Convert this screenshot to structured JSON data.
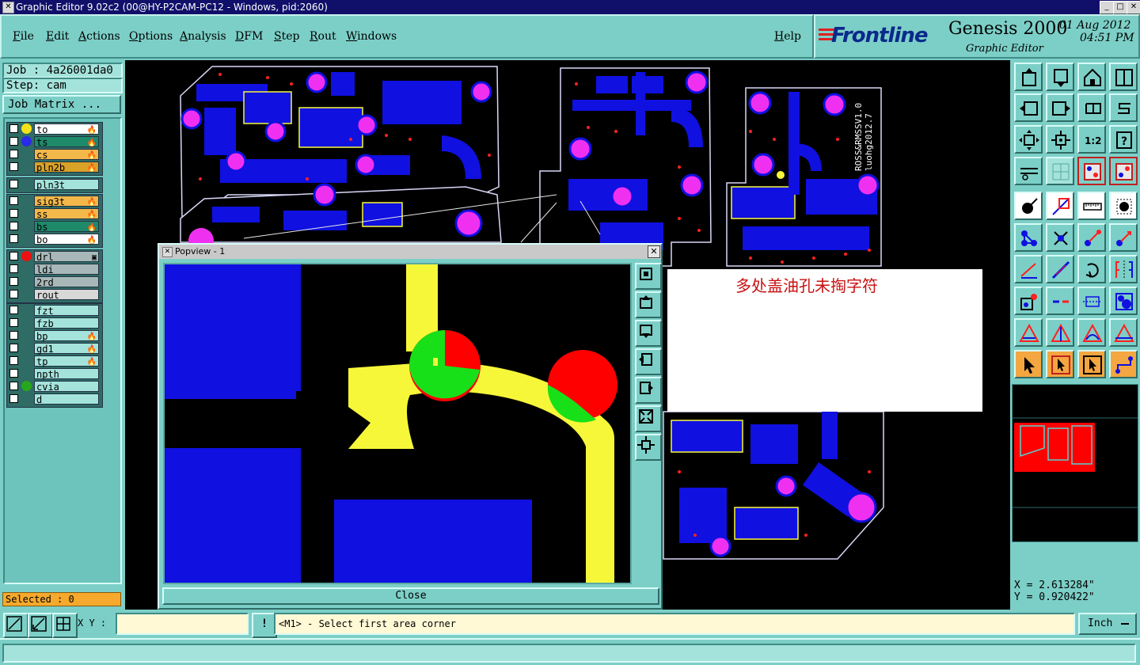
{
  "window": {
    "title": "Graphic Editor 9.02c2 (00@HY-P2CAM-PC12 - Windows, pid:2060)",
    "controls": [
      "_",
      "□",
      "✕"
    ]
  },
  "menu": {
    "items": [
      "File",
      "Edit",
      "Actions",
      "Options",
      "Analysis",
      "DFM",
      "Step",
      "Rout",
      "Windows"
    ],
    "help": "Help"
  },
  "brand": {
    "logo": "Frontline",
    "product": "Genesis 2000",
    "subtitle": "Graphic Editor",
    "date": "01 Aug 2012",
    "time": "04:51 PM"
  },
  "job": {
    "job_label": "Job : 4a26001da0",
    "step_label": "Step: cam",
    "matrix_button": "Job Matrix ..."
  },
  "layers": {
    "groups": [
      [
        {
          "name": "to",
          "bg": "#ffffff",
          "dot": "#f6e21a",
          "flame": "🔥"
        },
        {
          "name": "ts",
          "bg": "#1f8a6a",
          "dot": "#2a2ae8",
          "flame": "🔥"
        },
        {
          "name": "cs",
          "bg": "#f2b84a",
          "dot": "",
          "flame": "🔥"
        },
        {
          "name": "pln2b",
          "bg": "#d9a126",
          "dot": "",
          "flame": "🔥"
        }
      ],
      [
        {
          "name": "pln3t",
          "bg": "#a4e3db",
          "dot": "",
          "flame": ""
        }
      ],
      [
        {
          "name": "sig3t",
          "bg": "#f2b84a",
          "dot": "",
          "flame": "🔥"
        },
        {
          "name": "ss",
          "bg": "#f2b84a",
          "dot": "",
          "flame": "🔥"
        },
        {
          "name": "bs",
          "bg": "#1f8a6a",
          "dot": "",
          "flame": "🔥"
        },
        {
          "name": "bo",
          "bg": "#ffffff",
          "dot": "",
          "flame": "🔥"
        }
      ],
      [
        {
          "name": "drl",
          "bg": "#a8b8b8",
          "dot": "#ee1010",
          "flame": "▣"
        },
        {
          "name": "ldi",
          "bg": "#a8b8b8",
          "dot": "",
          "flame": ""
        },
        {
          "name": "2rd",
          "bg": "#a8b8b8",
          "dot": "",
          "flame": ""
        },
        {
          "name": "rout",
          "bg": "#d8d8d8",
          "dot": "",
          "flame": ""
        }
      ],
      [
        {
          "name": "fzt",
          "bg": "#a4e3db",
          "dot": "",
          "flame": ""
        },
        {
          "name": "fzb",
          "bg": "#a4e3db",
          "dot": "",
          "flame": ""
        },
        {
          "name": "bp",
          "bg": "#a4e3db",
          "dot": "",
          "flame": "🔥"
        },
        {
          "name": "gd1",
          "bg": "#a4e3db",
          "dot": "",
          "flame": "🔥"
        },
        {
          "name": "tp",
          "bg": "#a4e3db",
          "dot": "",
          "flame": "🔥"
        },
        {
          "name": "npth",
          "bg": "#a4e3db",
          "dot": "",
          "flame": ""
        },
        {
          "name": "cvia",
          "bg": "#a4e3db",
          "dot": "#27a81c",
          "flame": ""
        },
        {
          "name": "d",
          "bg": "#a4e3db",
          "dot": "",
          "flame": ""
        }
      ]
    ]
  },
  "selected_label": "Selected : 0",
  "popview": {
    "title": "Popview - 1",
    "close_button": "Close"
  },
  "pcb_text": {
    "line1": "ROSS&RMSSV1.0",
    "line2": "luohg2012.7"
  },
  "note": "多处盖油孔未掏字符",
  "coords": {
    "x": "X = 2.613284\"",
    "y": "Y = 0.920422\""
  },
  "status": {
    "xy_label": "X Y :",
    "xy_value": "",
    "warn": "!",
    "prompt": "<M1> - Select first area corner",
    "units": "Inch"
  },
  "colors": {
    "panel": "#7ccfc7",
    "copper": "#1010e0",
    "pad": "#f030f0",
    "trace": "#f7f73a",
    "hole_red": "#ff0000",
    "hole_green": "#18e018"
  }
}
